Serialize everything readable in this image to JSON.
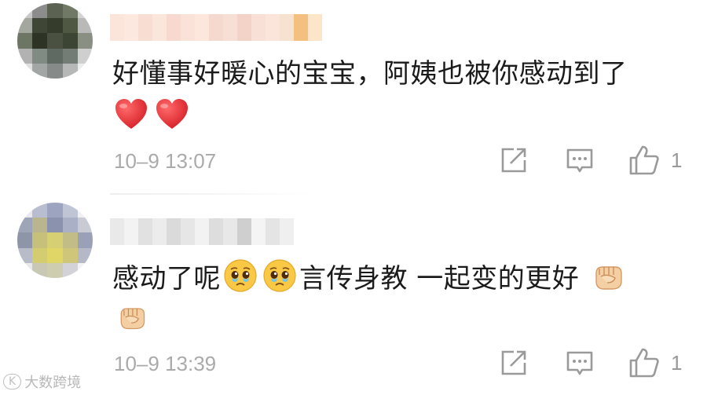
{
  "comments": [
    {
      "text": "好懂事好暖心的宝宝，阿姨也被你感动到了",
      "emoji_line": [
        "heart-emoji",
        "heart-emoji"
      ],
      "timestamp": "10–9 13:07",
      "like_count": "1"
    },
    {
      "text_before": "感动了呢",
      "inline_emojis": [
        "pleading-face-emoji",
        "pleading-face-emoji"
      ],
      "text_after": "言传身教 一起变的更好",
      "trailing_emoji": "fist-emoji",
      "emoji_line": [
        "fist-emoji"
      ],
      "timestamp": "10–9 13:39",
      "like_count": "1"
    }
  ],
  "icons": {
    "share": "share-icon",
    "reply": "comment-icon",
    "like": "thumbs-up-icon"
  },
  "watermark": {
    "logo_text": "K",
    "text": "大数跨境"
  },
  "colors": {
    "text": "#1b1b1b",
    "meta": "#aaaaaa",
    "icon": "#999999",
    "heart": "#e8343c",
    "emoji_face": "#f9c945"
  }
}
